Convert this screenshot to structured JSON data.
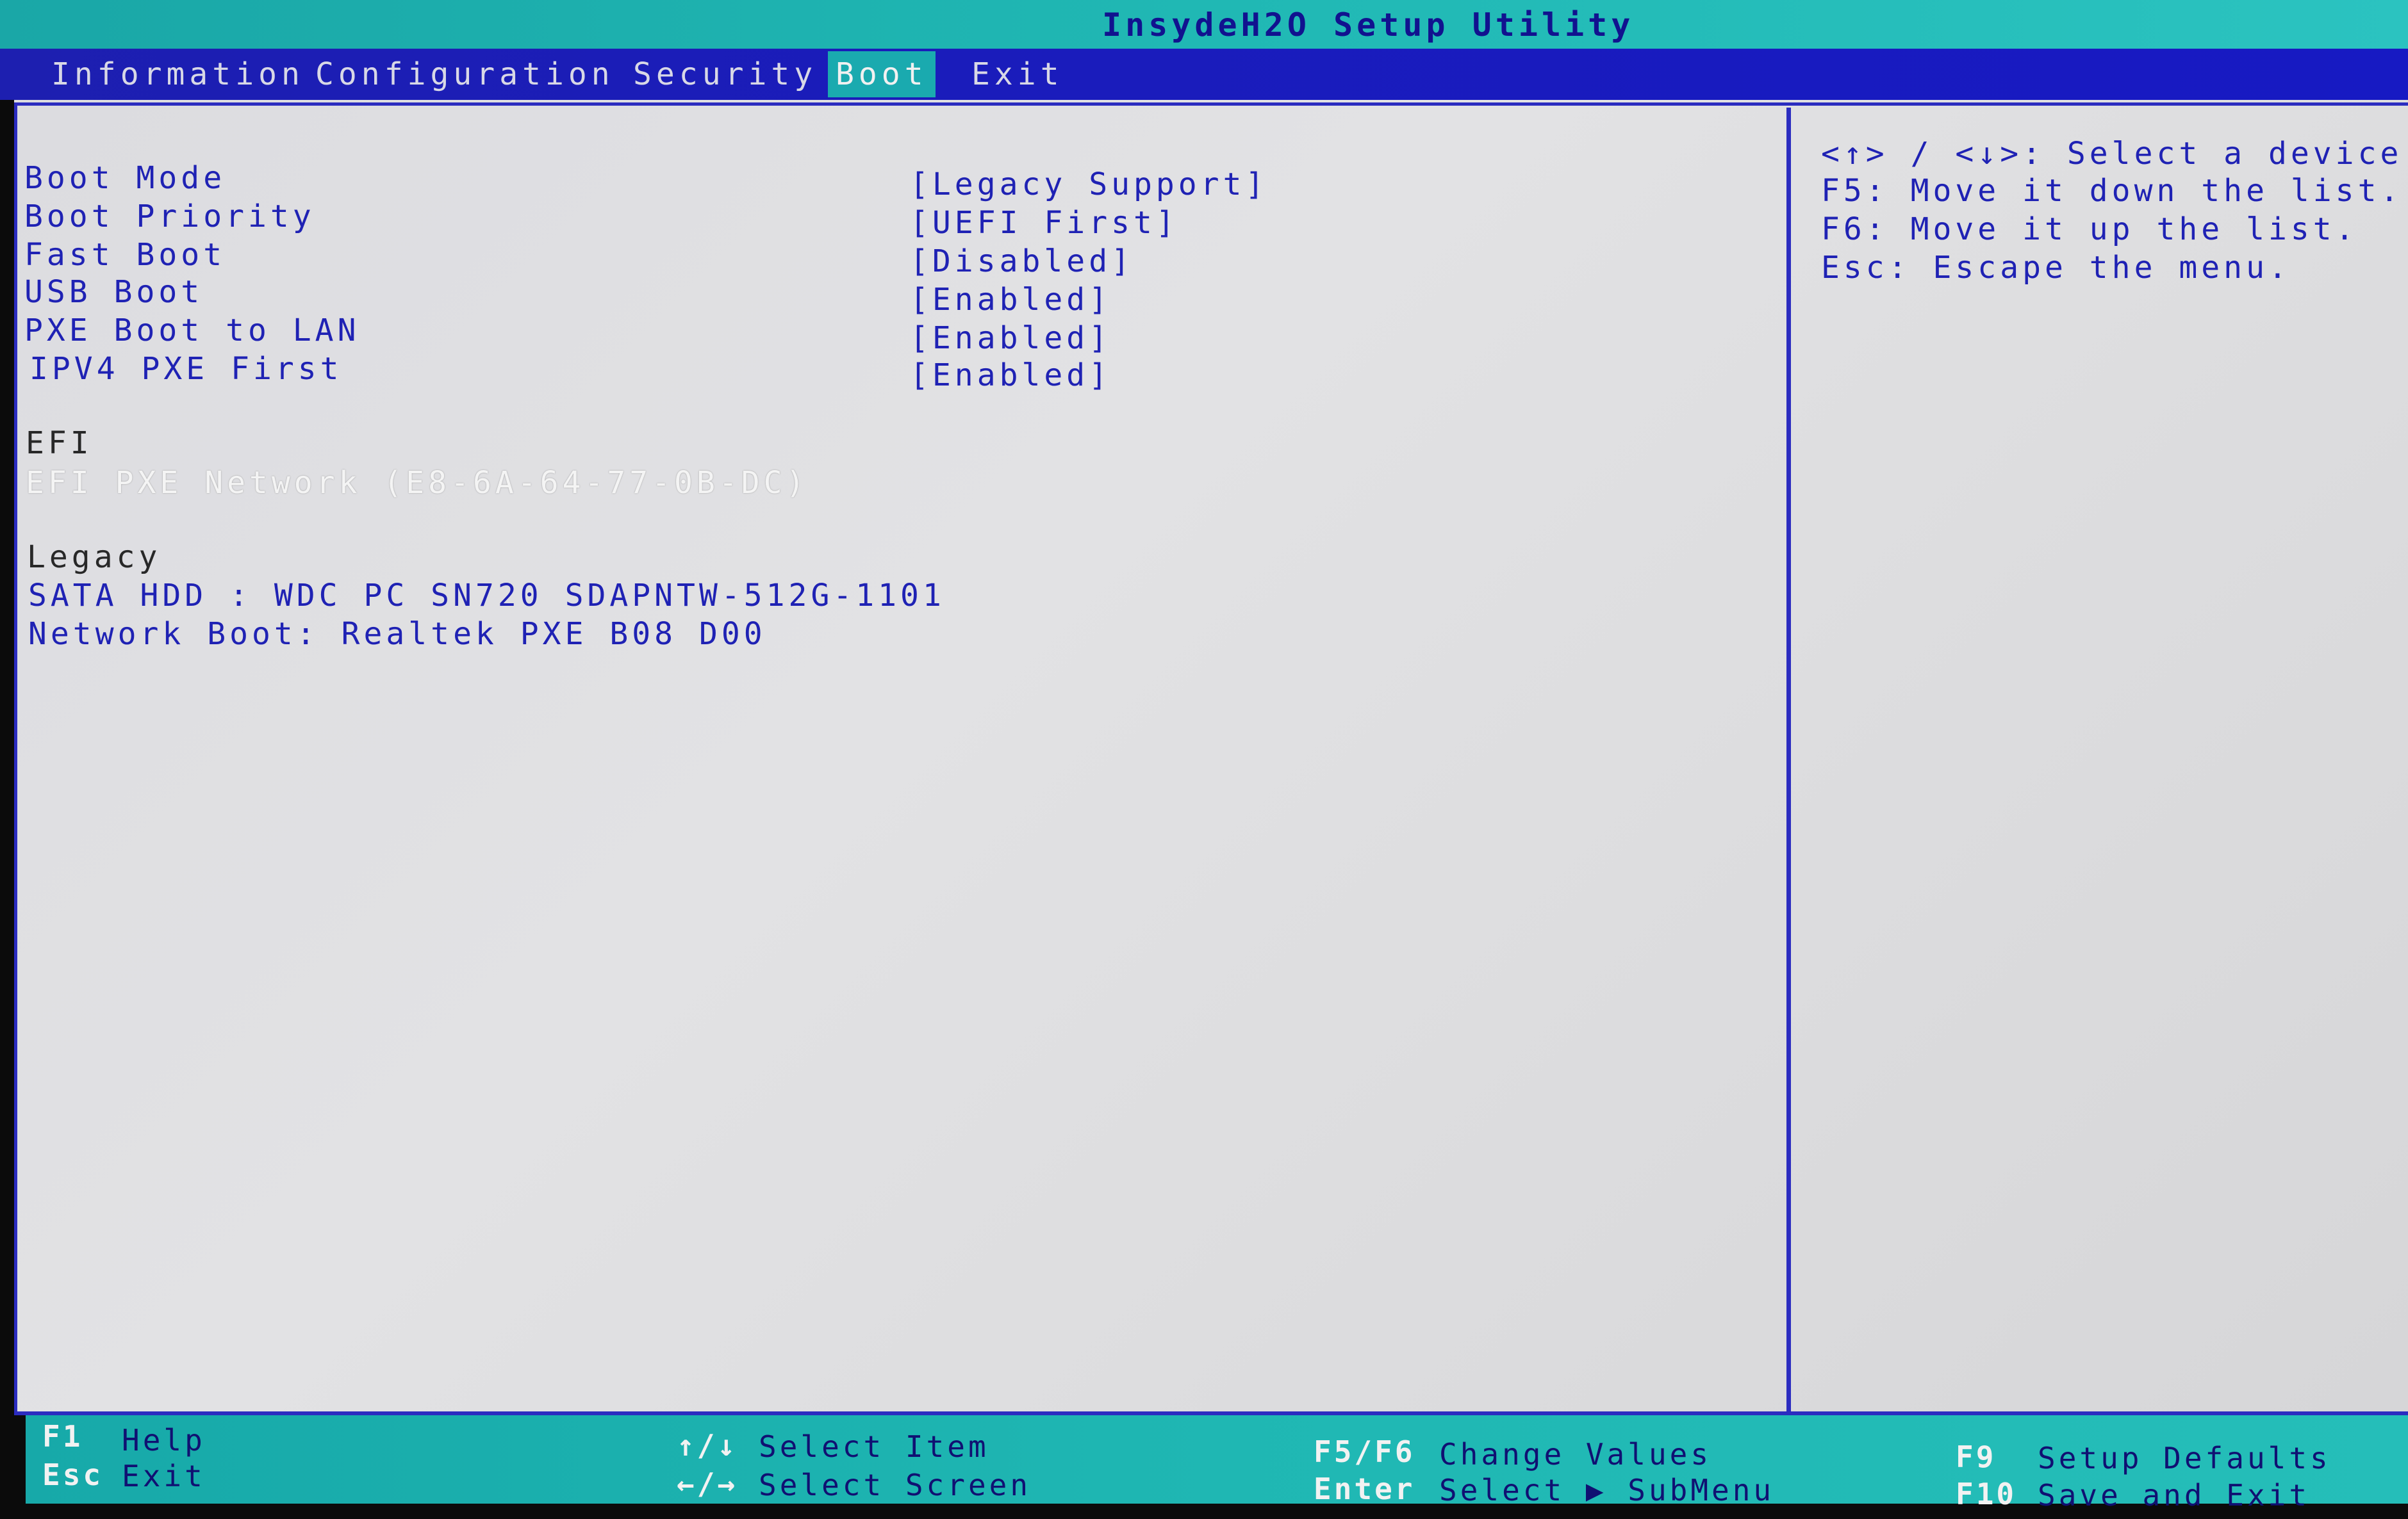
{
  "app": {
    "title": "InsydeH2O Setup Utility"
  },
  "menu": {
    "items": [
      {
        "label": "Information"
      },
      {
        "label": "Configuration"
      },
      {
        "label": "Security"
      },
      {
        "label": "Boot",
        "active": true
      },
      {
        "label": "Exit"
      }
    ]
  },
  "settings": [
    {
      "label": "Boot Mode",
      "value": "[Legacy Support]"
    },
    {
      "label": "Boot Priority",
      "value": "[UEFI First]"
    },
    {
      "label": "Fast Boot",
      "value": "[Disabled]"
    },
    {
      "label": "USB Boot",
      "value": "[Enabled]"
    },
    {
      "label": "PXE Boot to LAN",
      "value": "[Enabled]"
    },
    {
      "label": "IPV4 PXE First",
      "value": "[Enabled]"
    }
  ],
  "efi": {
    "header": "EFI",
    "devices": [
      "EFI PXE Network (E8-6A-64-77-0B-DC)"
    ]
  },
  "legacy": {
    "header": "Legacy",
    "devices": [
      "SATA HDD     : WDC PC SN720 SDAPNTW-512G-1101",
      "Network Boot: Realtek PXE B08 D00"
    ]
  },
  "help": {
    "lines": [
      "<↑> / <↓>: Select a device.",
      "F5: Move it down the list.",
      "F6: Move it up the list.",
      "Esc: Escape the menu."
    ]
  },
  "footer": {
    "f1_key": "F1",
    "f1_desc": "Help",
    "esc_key": "Esc",
    "esc_desc": "Exit",
    "updown_key": "↑/↓",
    "updown_desc": "Select Item",
    "leftright_key": "←/→",
    "leftright_desc": "Select Screen",
    "f5f6_key": "F5/F6",
    "f5f6_desc": "Change Values",
    "enter_key": "Enter",
    "enter_desc": "Select ▶ SubMenu",
    "f9_key": "F9",
    "f9_desc": "Setup Defaults",
    "f10_key": "F10",
    "f10_desc": "Save and Exit"
  },
  "colors": {
    "title_bar": "#20b8b4",
    "menu_bar": "#1a1cbb",
    "active_tab": "#1aaaaf",
    "text_blue": "#1f22b4",
    "background": "#dcdce0"
  }
}
